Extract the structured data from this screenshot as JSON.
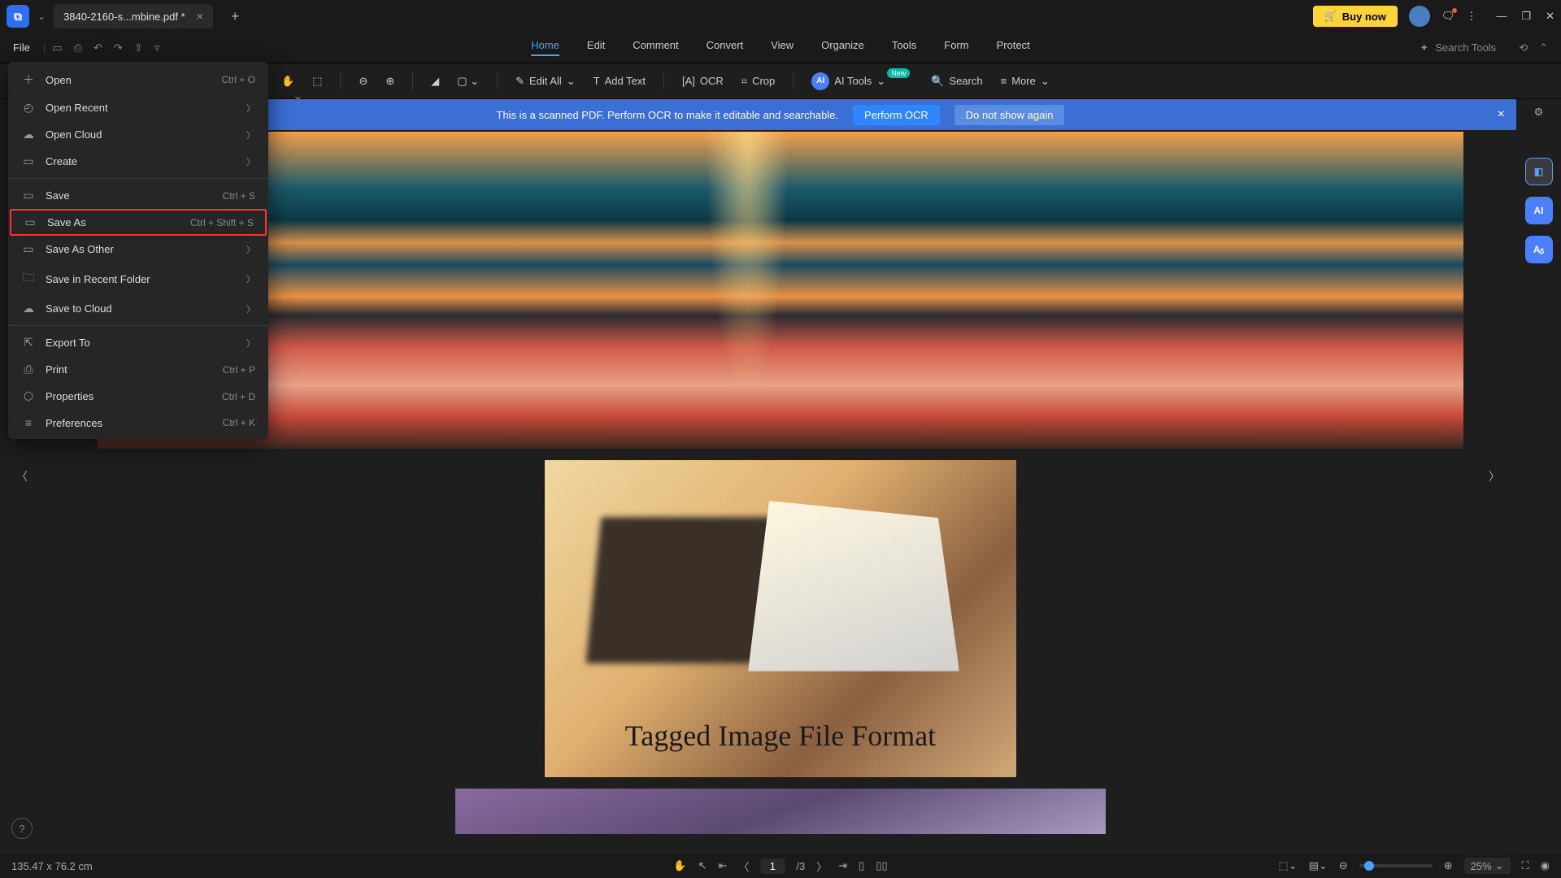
{
  "titlebar": {
    "tab_name": "3840-2160-s...mbine.pdf *",
    "buy_label": "Buy now"
  },
  "menubar": {
    "file": "File",
    "tabs": [
      "Home",
      "Edit",
      "Comment",
      "Convert",
      "View",
      "Organize",
      "Tools",
      "Form",
      "Protect"
    ],
    "active_tab": "Home",
    "search_placeholder": "Search Tools"
  },
  "toolbar": {
    "edit_all": "Edit All",
    "add_text": "Add Text",
    "ocr": "OCR",
    "crop": "Crop",
    "ai_tools": "AI Tools",
    "search": "Search",
    "more": "More",
    "new_badge": "New"
  },
  "banner": {
    "msg": "This is a scanned PDF. Perform OCR to make it editable and searchable.",
    "perform": "Perform OCR",
    "dismiss": "Do not show again"
  },
  "file_menu": {
    "items": [
      {
        "icon": "＋",
        "label": "Open",
        "shortcut": "Ctrl + O",
        "arrow": false
      },
      {
        "icon": "◴",
        "label": "Open Recent",
        "shortcut": "",
        "arrow": true
      },
      {
        "icon": "☁",
        "label": "Open Cloud",
        "shortcut": "",
        "arrow": true
      },
      {
        "icon": "▭",
        "label": "Create",
        "shortcut": "",
        "arrow": true
      }
    ],
    "items2": [
      {
        "icon": "▭",
        "label": "Save",
        "shortcut": "Ctrl + S",
        "arrow": false,
        "hl": false
      },
      {
        "icon": "▭",
        "label": "Save As",
        "shortcut": "Ctrl + Shift + S",
        "arrow": false,
        "hl": true
      },
      {
        "icon": "▭",
        "label": "Save As Other",
        "shortcut": "",
        "arrow": true,
        "hl": false
      },
      {
        "icon": "🗀",
        "label": "Save in Recent Folder",
        "shortcut": "",
        "arrow": true,
        "hl": false
      },
      {
        "icon": "☁",
        "label": "Save to Cloud",
        "shortcut": "",
        "arrow": true,
        "hl": false
      }
    ],
    "items3": [
      {
        "icon": "⇱",
        "label": "Export To",
        "shortcut": "",
        "arrow": true
      },
      {
        "icon": "⎙",
        "label": "Print",
        "shortcut": "Ctrl + P",
        "arrow": false
      },
      {
        "icon": "⬡",
        "label": "Properties",
        "shortcut": "Ctrl + D",
        "arrow": false
      },
      {
        "icon": "≡",
        "label": "Preferences",
        "shortcut": "Ctrl + K",
        "arrow": false
      }
    ]
  },
  "document": {
    "tiff_caption": "Tagged Image File Format"
  },
  "statusbar": {
    "dimensions": "135.47 x 76.2 cm",
    "page_current": "1",
    "page_total": "/3",
    "zoom": "25%"
  }
}
